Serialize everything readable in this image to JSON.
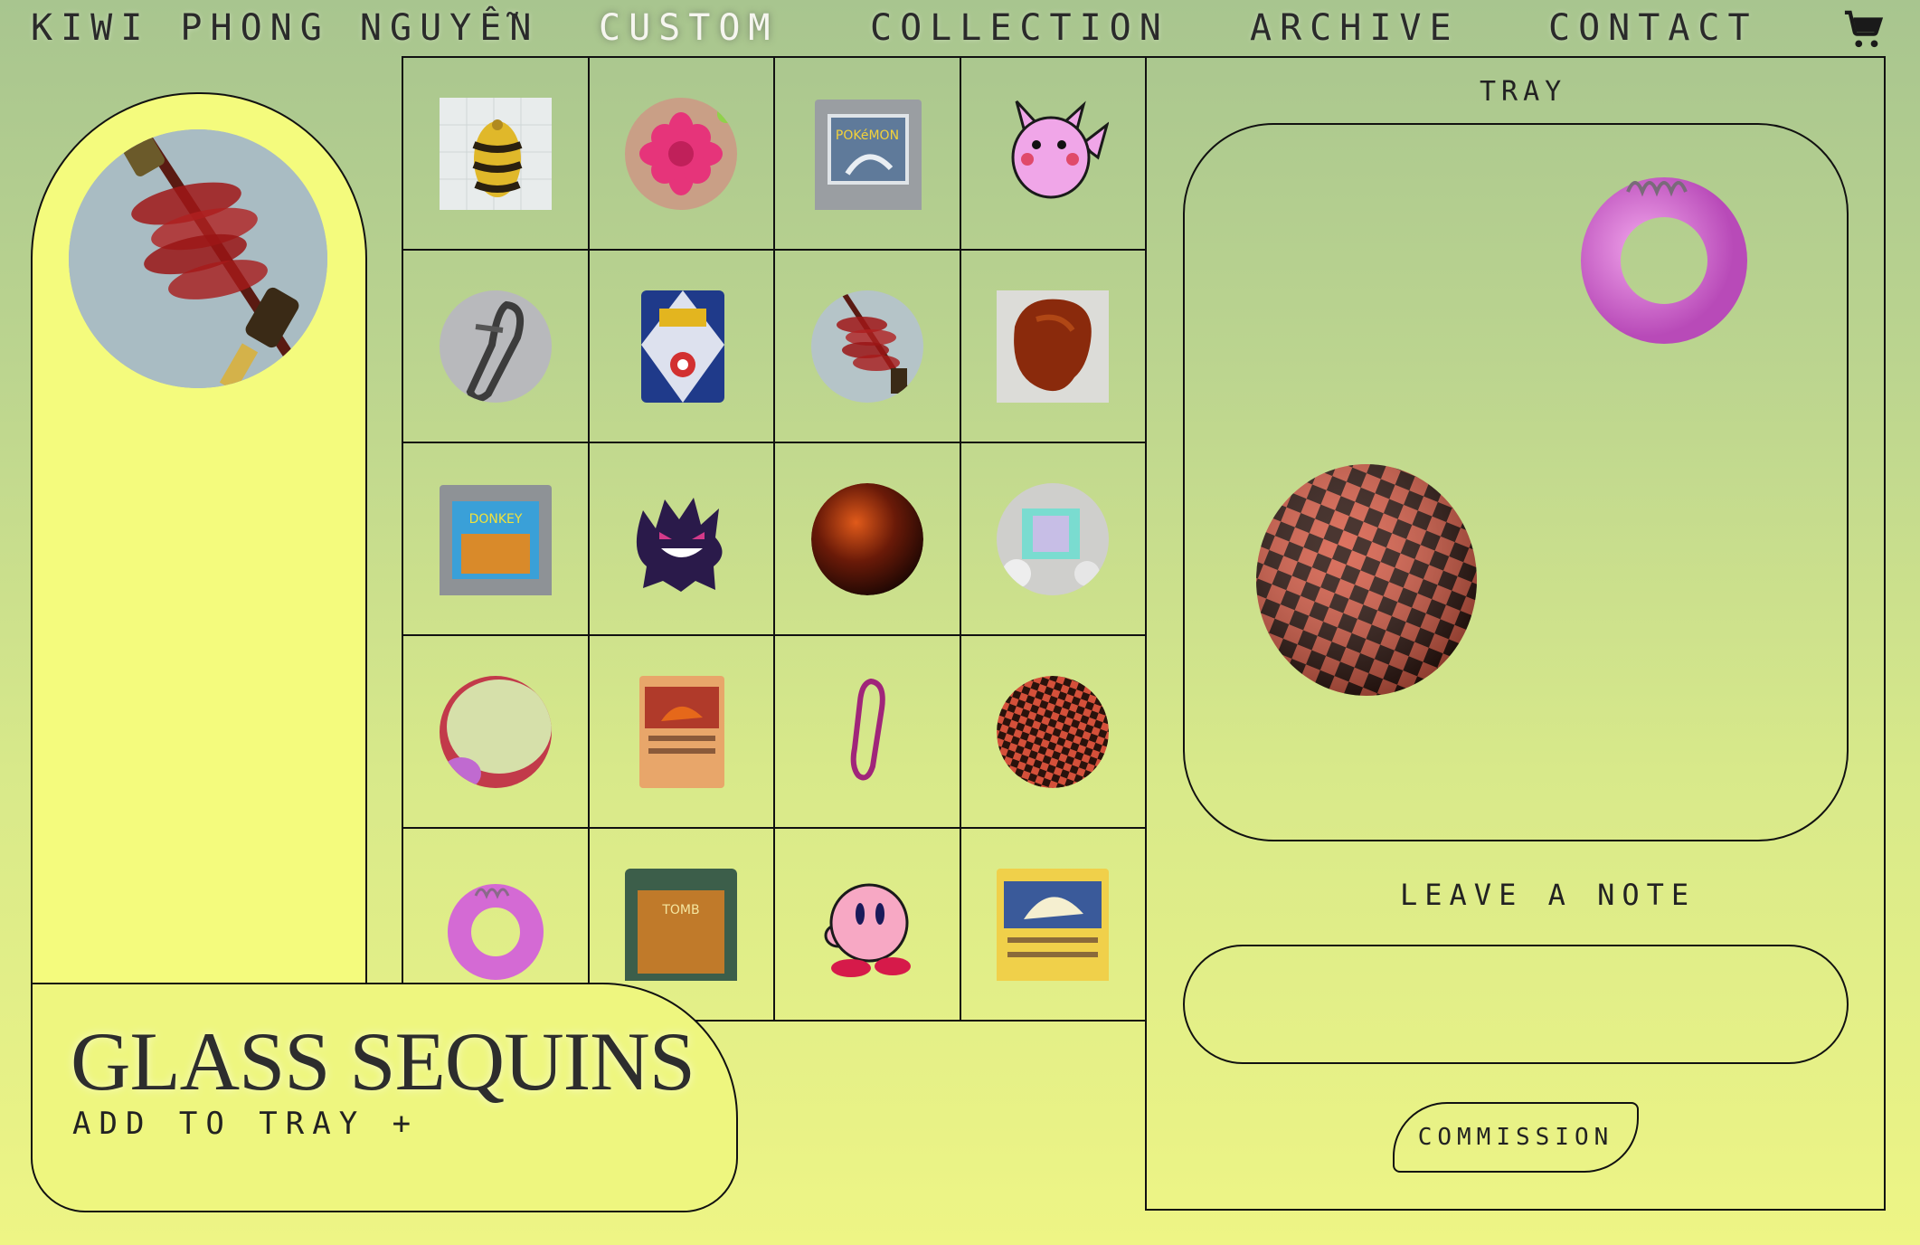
{
  "nav": {
    "brand": "KIWI PHONG NGUYỄN",
    "links": [
      "CUSTOM",
      "COLLECTION",
      "ARCHIVE",
      "CONTACT"
    ],
    "active": "CUSTOM",
    "cart_icon": "shopping-cart-icon"
  },
  "product": {
    "title": "GLASS SEQUINS",
    "add_label": "ADD TO TRAY +"
  },
  "grid": {
    "items": [
      "striped-bead",
      "pink-flower-bead",
      "pokemon-silver-cartridge",
      "pikachu-sprite",
      "carabiner-silver",
      "pokemon-card-back",
      "glass-sequins",
      "amber-bead",
      "donkey-kong-cartridge",
      "gengar-sprite",
      "red-amber-marble",
      "holographic-charm",
      "jade-bead",
      "charizard-card",
      "pink-carabiner",
      "checkered-ball",
      "pink-ring-charm",
      "tomb-raider-cartridge",
      "kirby-sprite",
      "ninetales-card"
    ]
  },
  "tray": {
    "title": "TRAY",
    "items": [
      "pink-ring-charm",
      "checkered-ball"
    ]
  },
  "note": {
    "title": "LEAVE A NOTE",
    "value": ""
  },
  "commission": {
    "label": "COMMISSION"
  },
  "colors": {
    "bg_top": "#a8c58f",
    "bg_bottom": "#eef585",
    "panel_fill": "#f4fb7d",
    "line": "#111111"
  }
}
